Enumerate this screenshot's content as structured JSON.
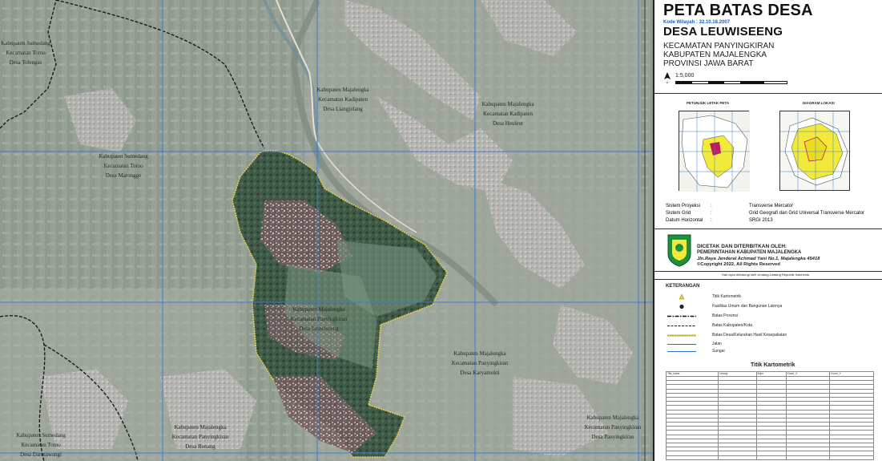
{
  "map": {
    "labels": [
      {
        "lines": [
          "Kabupaten Sumedang",
          "Kecamatan Tomo",
          "Desa Tolengas"
        ]
      },
      {
        "lines": [
          "Kabupaten Majalengka",
          "Kecamatan Kadipaten",
          "Desa Liangjulang"
        ]
      },
      {
        "lines": [
          "Kabupaten Majalengka",
          "Kecamatan Kadipaten",
          "Desa Heuleut"
        ]
      },
      {
        "lines": [
          "Kabupaten Sumedang",
          "Kecamatan Tomo",
          "Desa Marongge"
        ]
      },
      {
        "lines": [
          "Kabupaten Majalengka",
          "Kecamatan Panyingkiran",
          "Desa Leuwiseeng"
        ]
      },
      {
        "lines": [
          "Kabupaten Majalengka",
          "Kecamatan Panyingkiran",
          "Desa Karyamukti"
        ]
      },
      {
        "lines": [
          "Kabupaten Sumedang",
          "Kecamatan Tomo",
          "Desa Darmawangi"
        ]
      },
      {
        "lines": [
          "Kabupaten Majalengka",
          "Kecamatan Panyingkiran",
          "Desa Bonang"
        ]
      },
      {
        "lines": [
          "Kabupaten Majalengka",
          "Kecamatan Panyingkiran",
          "Desa Panyingkiran"
        ]
      }
    ]
  },
  "panel": {
    "title1": "PETA BATAS DESA",
    "kode": "Kode Wilayah : 32.10.18.2007",
    "title2": "DESA LEUWISEENG",
    "kecamatan": "KECAMATAN PANYINGKIRAN",
    "kabupaten": "KABUPATEN MAJALENGKA",
    "provinsi": "PROVINSI JAWA BARAT",
    "scale": "1:5,000",
    "inset_left_title": "PETUNJUK LETAK PETA",
    "inset_right_title": "DIAGRAM LOKASI",
    "info": [
      {
        "label": "Sistem Proyeksi",
        "value": "Transverse Mercator"
      },
      {
        "label": "Sistem Grid",
        "value": "Grid Geografi dan Grid Universal Transverse Mercator"
      },
      {
        "label": "Datum Horizontal",
        "value": "SRGI 2013"
      }
    ],
    "publisher_heading": "DICETAK DAN DITERBITKAN OLEH:",
    "publisher_name": "PEMERINTAHAN KABUPATEN MAJALENGKA",
    "publisher_address": "Jln.Raya Jenderal Achmad Yani No.1, Majalengka 45418",
    "copyright": "©Copyright 2022, All Rights Reserved",
    "copyright_note": "Hak cipta dilindungi oleh Undang-Undang Republik Indonesia",
    "legend_title": "KETERANGAN",
    "legend": [
      {
        "label": "Titik Kartometrik"
      },
      {
        "label": "Fasilitas Umum dan Bangunan Lainnya"
      },
      {
        "label": "Batas Provinsi"
      },
      {
        "label": "Batas Kabupaten/Kota"
      },
      {
        "label": "Batas Desa/Kelurahan Hasil Kesepakatan"
      },
      {
        "label": "Jalan"
      },
      {
        "label": "Sungai"
      }
    ],
    "tk_title": "Titik Kartometrik",
    "tk_headers": [
      "Titik_batas",
      "Lintang",
      "Bujur",
      "Koord_X",
      "Koord_Y"
    ]
  },
  "colors": {
    "village_outline": "#e8d24a",
    "road": "#d9342b",
    "river": "#2f6fd6",
    "grid": "#3c7bd8",
    "highlight_yellow": "#f2ea3a"
  }
}
